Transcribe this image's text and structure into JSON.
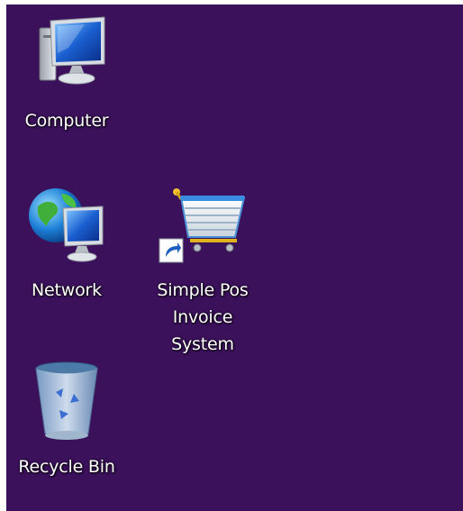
{
  "desktop": {
    "background_color": "#3b115b",
    "icons": [
      {
        "label": "Computer",
        "icon": "computer-icon"
      },
      {
        "label": "Network",
        "icon": "network-icon"
      },
      {
        "label": "Simple Pos\nInvoice\nSystem",
        "icon": "shopping-cart-icon",
        "shortcut": true
      },
      {
        "label": "Recycle Bin",
        "icon": "recycle-bin-icon"
      }
    ]
  }
}
